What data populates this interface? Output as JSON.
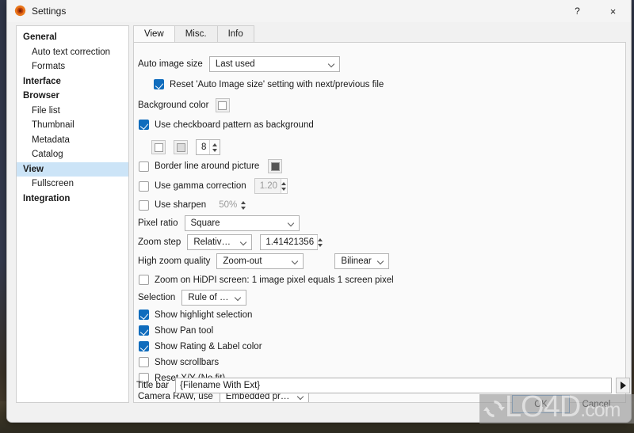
{
  "window": {
    "title": "Settings",
    "app_icon": "gear-icon",
    "help_label": "?",
    "close_label": "×"
  },
  "sidebar": {
    "items": [
      {
        "label": "General",
        "level": "top",
        "selected": false
      },
      {
        "label": "Auto text correction",
        "level": "sub",
        "selected": false
      },
      {
        "label": "Formats",
        "level": "sub",
        "selected": false
      },
      {
        "label": "Interface",
        "level": "top",
        "selected": false
      },
      {
        "label": "Browser",
        "level": "top",
        "selected": false
      },
      {
        "label": "File list",
        "level": "sub",
        "selected": false
      },
      {
        "label": "Thumbnail",
        "level": "sub",
        "selected": false
      },
      {
        "label": "Metadata",
        "level": "sub",
        "selected": false
      },
      {
        "label": "Catalog",
        "level": "sub",
        "selected": false
      },
      {
        "label": "View",
        "level": "top",
        "selected": true
      },
      {
        "label": "Fullscreen",
        "level": "sub",
        "selected": false
      },
      {
        "label": "Integration",
        "level": "top",
        "selected": false
      }
    ]
  },
  "tabs": [
    {
      "label": "View",
      "active": true
    },
    {
      "label": "Misc.",
      "active": false
    },
    {
      "label": "Info",
      "active": false
    }
  ],
  "view": {
    "auto_image_size_label": "Auto image size",
    "auto_image_size_value": "Last used",
    "reset_auto_label": "Reset 'Auto Image size' setting with next/previous file",
    "reset_auto_checked": true,
    "background_color_label": "Background color",
    "background_color_value": "#ffffff",
    "checkboard_label": "Use checkboard pattern as background",
    "checkboard_checked": true,
    "checkboard_color_1": "#ffffff",
    "checkboard_color_2": "#dcdcdc",
    "checkboard_size": "8",
    "border_line_label": "Border line around picture",
    "border_line_checked": false,
    "border_line_color": "#555555",
    "gamma_label": "Use gamma correction",
    "gamma_checked": false,
    "gamma_value": "1.20",
    "sharpen_label": "Use sharpen",
    "sharpen_checked": false,
    "sharpen_value": "50%",
    "pixel_ratio_label": "Pixel ratio",
    "pixel_ratio_value": "Square",
    "zoom_step_label": "Zoom step",
    "zoom_step_mode": "Relative step",
    "zoom_step_value": "1.41421356",
    "high_zoom_label": "High zoom quality",
    "high_zoom_mode": "Zoom-out",
    "high_zoom_filter": "Bilinear",
    "hidpi_label": "Zoom on HiDPI screen: 1 image pixel equals 1 screen pixel",
    "hidpi_checked": false,
    "selection_label": "Selection",
    "selection_value": "Rule of thirds",
    "highlight_label": "Show highlight selection",
    "highlight_checked": true,
    "pan_label": "Show Pan tool",
    "pan_checked": true,
    "rating_label": "Show Rating & Label color",
    "rating_checked": true,
    "scrollbars_label": "Show scrollbars",
    "scrollbars_checked": false,
    "resetxy_label": "Reset X/Y (No fit)",
    "resetxy_checked": false,
    "camera_raw_label": "Camera RAW, use",
    "camera_raw_value": "Embedded preview",
    "title_bar_label": "Title bar",
    "title_bar_value": "{Filename With Ext}",
    "title_bar_token_button": "insert-token-arrow"
  },
  "footer": {
    "ok_label": "OK",
    "cancel_label": "Cancel"
  },
  "watermark": {
    "text_main": "LO4D",
    "text_suffix": ".com",
    "logo": "circular-arrows-icon"
  },
  "colors": {
    "accent": "#0f6cbd",
    "selection_bg": "#cce4f7",
    "panel_bg": "#fafafa",
    "window_bg": "#f1f1f1"
  }
}
